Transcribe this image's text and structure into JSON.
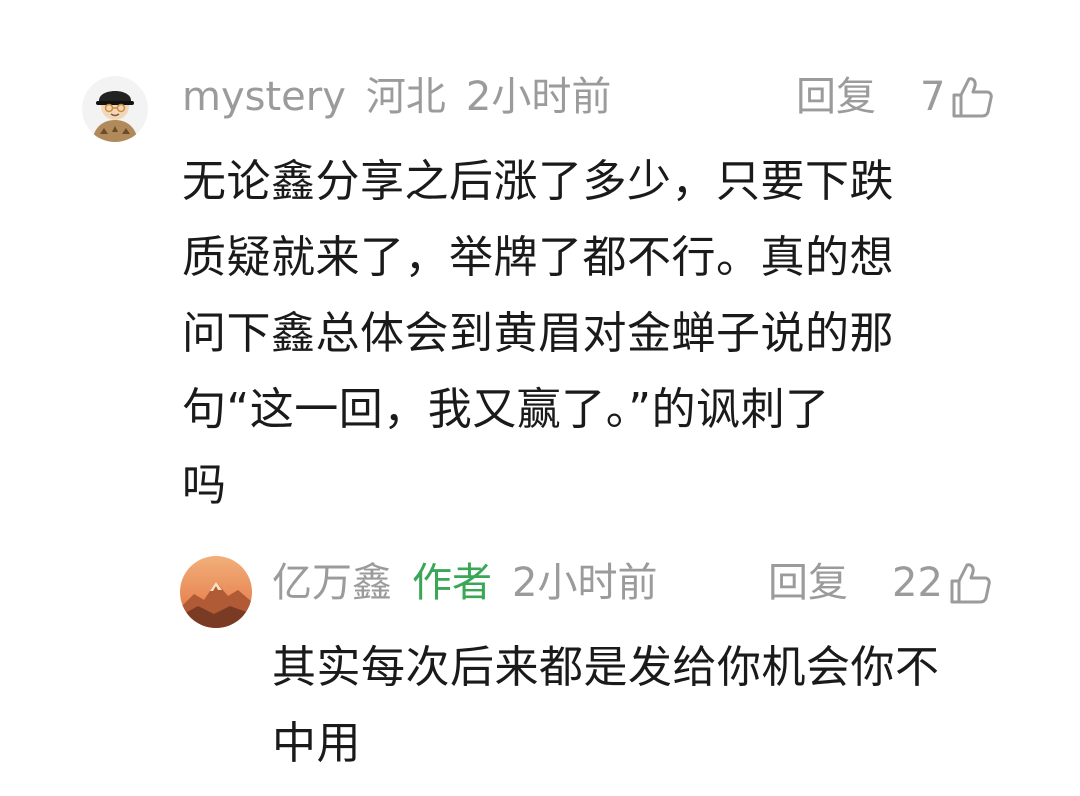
{
  "comment": {
    "username": "mystery",
    "location": "河北",
    "time": "2小时前",
    "reply_label": "回复",
    "like_count": "7",
    "body_lines": [
      "无论鑫分享之后涨了多少，只要下跌",
      "质疑就来了，举牌了都不行。真的想",
      "问下鑫总体会到黄眉对金蝉子说的那",
      "句“这一回，我又赢了。”的讽刺了",
      "吗"
    ],
    "avatar_icon": "avatar-cartoon-hat-icon",
    "like_icon": "thumbs-up-icon"
  },
  "reply": {
    "username": "亿万鑫",
    "author_tag": "作者",
    "time": "2小时前",
    "reply_label": "回复",
    "like_count": "22",
    "body_lines": [
      "其实每次后来都是发给你机会你不",
      "中用"
    ],
    "avatar_icon": "avatar-mountain-sunset-icon",
    "like_icon": "thumbs-up-icon"
  },
  "colors": {
    "meta_gray": "#9b9b9b",
    "body_text": "#1a1a1a",
    "author_green": "#3aa757",
    "background": "#ffffff"
  }
}
